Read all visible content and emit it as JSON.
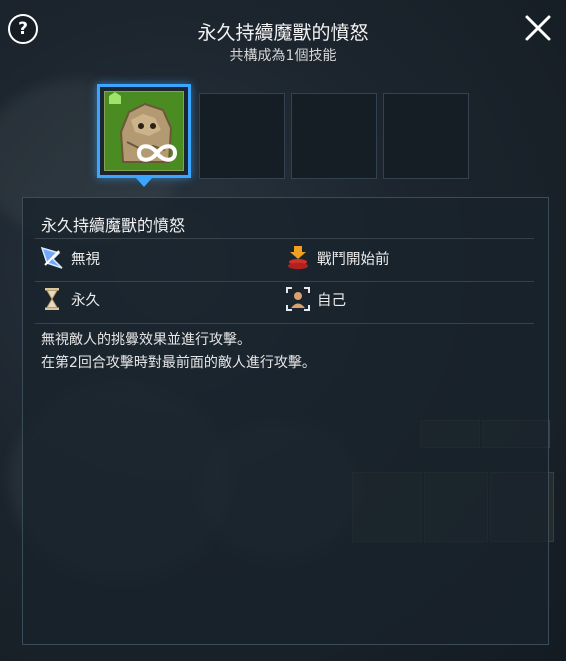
{
  "header": {
    "title": "永久持續魔獸的憤怒",
    "subtitle": "共構成為1個技能"
  },
  "slots": [
    {
      "state": "selected",
      "icon": "stone-golem-infinity-icon"
    },
    {
      "state": "empty"
    },
    {
      "state": "empty"
    },
    {
      "state": "empty"
    }
  ],
  "panel": {
    "skill_name": "永久持續魔獸的憤怒",
    "attributes": {
      "type_label": "無視",
      "timing_label": "戰鬥開始前",
      "duration_label": "永久",
      "target_label": "自己"
    },
    "description_lines": [
      "無視敵人的挑釁效果並進行攻擊。",
      "在第2回合攻擊時對最前面的敵人進行攻擊。"
    ]
  },
  "colors": {
    "accent": "#3aa6ff",
    "panel_bg": "#18222c"
  }
}
